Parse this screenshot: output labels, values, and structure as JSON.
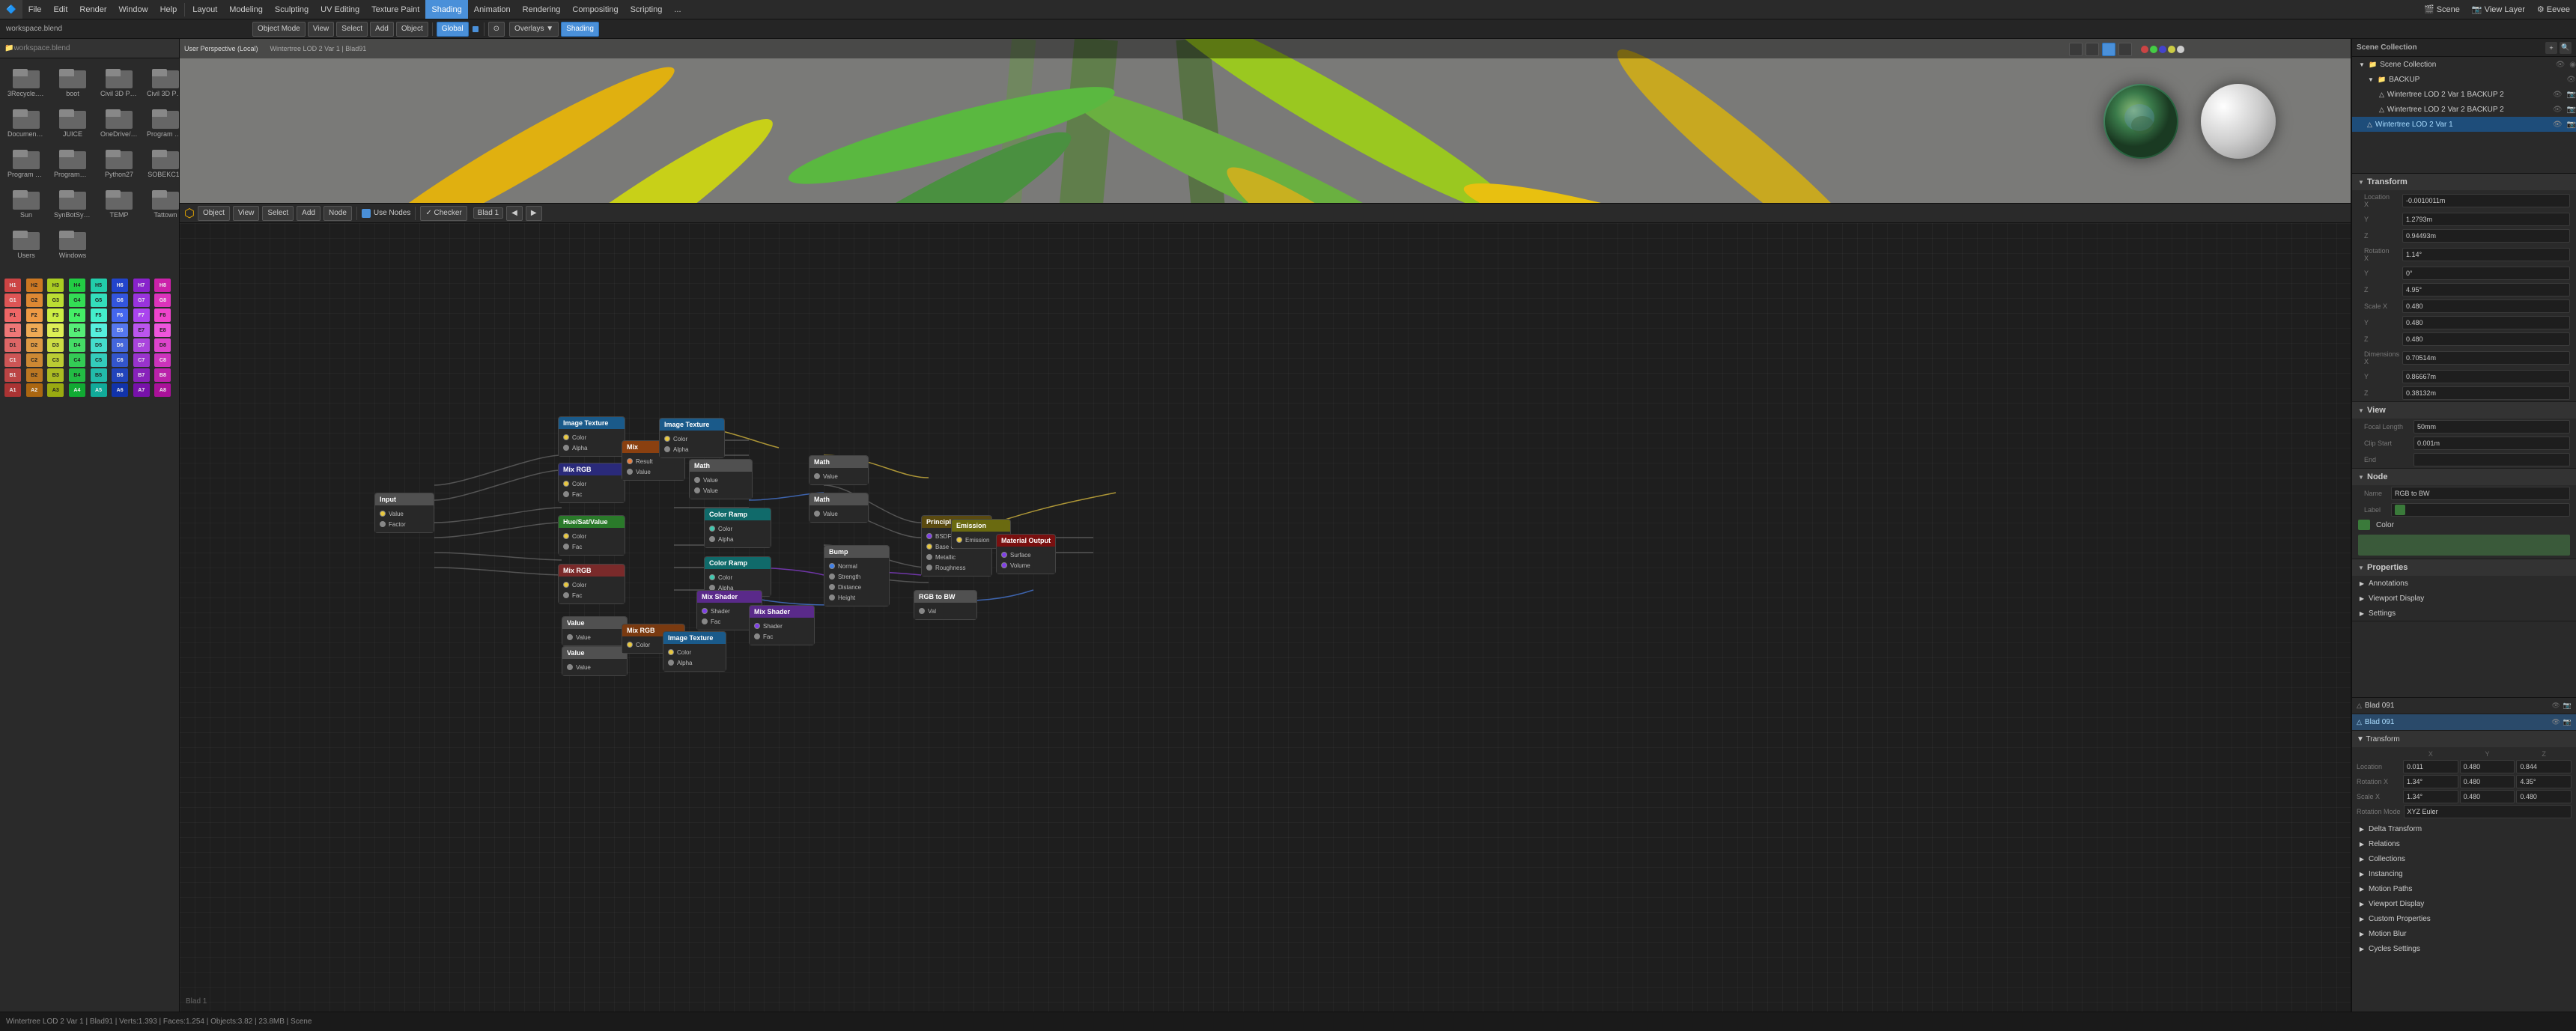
{
  "topMenu": {
    "items": [
      "Blender",
      "File",
      "Edit",
      "Render",
      "Window",
      "Help",
      "Layout",
      "Modeling",
      "Sculpting",
      "UV Editing",
      "Texture Paint",
      "Shading",
      "Animation",
      "Rendering",
      "Compositing",
      "Scripting",
      "..."
    ]
  },
  "workspaceFile": "workspace.blend",
  "viewport": {
    "mode": "Object Mode",
    "view": "View",
    "select": "Select",
    "add": "Add",
    "object": "Object",
    "orientation": "Global",
    "perspective": "User Perspective (Local)",
    "collection": "Wintertree LOD 2 Var 1 | Blad91"
  },
  "nodeEditor": {
    "header": {
      "mode": "Object",
      "view": "View",
      "select": "Select",
      "add": "Add",
      "node": "Node",
      "useNodes": "Use Nodes",
      "label": "Blad 1"
    }
  },
  "rightPanel": {
    "transform": {
      "title": "Transform",
      "location": {
        "label": "Location",
        "x": "-0.0010011m",
        "y": "1.2793m",
        "z": "0.94493m"
      },
      "rotation": {
        "label": "Rotation",
        "x": "1.14°",
        "y": "0°",
        "z": "4.95°",
        "mode": "XYZ Euler"
      },
      "scale": {
        "label": "Scale",
        "x": "0.480",
        "y": "0.480",
        "z": "0.480"
      },
      "dimensions": {
        "label": "Dimensions",
        "x": "0.70514m",
        "y": "0.86667m",
        "z": "0.38132m"
      }
    },
    "view": {
      "title": "View",
      "focalLength": "50mm",
      "clipStart": "0.001m",
      "clipEnd": ""
    },
    "node": {
      "title": "Node",
      "name": "RGB to BW",
      "label": "",
      "color": "Color"
    },
    "properties": {
      "title": "Properties",
      "annotations": "Annotations",
      "viewportDisplay": "Viewport Display",
      "settings": "Settings"
    },
    "sceneCollection": {
      "title": "Scene Collection",
      "items": [
        {
          "name": "Scene Collection",
          "level": 0,
          "expanded": true
        },
        {
          "name": "BACKUP",
          "level": 1,
          "expanded": true
        },
        {
          "name": "Wintertree LOD 2 Var 1 BACKUP 2",
          "level": 2,
          "visible": true
        },
        {
          "name": "Wintertree LOD 2 Var 2 BACKUP 2",
          "level": 2,
          "visible": true
        },
        {
          "name": "Wintertree LOD 2 Var 1",
          "level": 1,
          "selected": true,
          "visible": true
        }
      ]
    }
  },
  "bottomRightPanel": {
    "items": [
      {
        "name": "Blad 091",
        "id": "Blad 091",
        "selected": false
      },
      {
        "name": "Blad 091",
        "id": "Blad 091b",
        "selected": true
      }
    ],
    "transform": {
      "locationX": "0.011",
      "locationY": "0.480",
      "locationZ": "0.844",
      "rotationX": "1.34°",
      "rotationY": "0.480",
      "rotationZ": "4.35°",
      "scaleX": "1.34°",
      "scaleY": "0.480",
      "scaleZ": "0.480",
      "rotationMode": "XYZ Euler"
    },
    "sections": [
      "Delta Transform",
      "Relations",
      "Collections",
      "Instancing",
      "Motion Paths",
      "Viewport Display",
      "Custom Properties",
      "Motion Blur",
      "Cycles Settings"
    ]
  },
  "statusBar": {
    "info": "Wintertree LOD 2 Var 1 | Blad91 | Verts:1.393 | Faces:1.254 | Objects:3.82 | 23.8MB | Scene"
  },
  "fileBrowser": {
    "title": "workspace.blend",
    "folders": [
      "3Recycle.Bin",
      "boot",
      "Civil 3D Props.",
      "Civil 3D Props.",
      "Documents s.",
      "JUICE",
      "OneDrive/Temp",
      "Program Files",
      "Program Files.",
      "ProgramData",
      "Python27",
      "SOBEKC12",
      "Sun",
      "SynBotSyNo.",
      "TEMP",
      "Tattown",
      "Users",
      "Windows"
    ]
  },
  "colorPalette": {
    "rows": [
      [
        "H1",
        "H2",
        "H3",
        "H4",
        "H5",
        "H6",
        "H7",
        "H8"
      ],
      [
        "G1",
        "G2",
        "G3",
        "G4",
        "G5",
        "G6",
        "G7",
        "G8"
      ],
      [
        "P1",
        "F2",
        "F3",
        "F4",
        "F5",
        "F6",
        "F7",
        "F8"
      ],
      [
        "E1",
        "E2",
        "E3",
        "E4",
        "E5",
        "E6",
        "E7",
        "E8"
      ],
      [
        "D1",
        "D2",
        "D3",
        "D4",
        "D5",
        "D6",
        "D7",
        "D8"
      ],
      [
        "C1",
        "C2",
        "C3",
        "C4",
        "C5",
        "C6",
        "C7",
        "C8"
      ],
      [
        "B1",
        "B2",
        "B3",
        "B4",
        "B5",
        "B6",
        "B7",
        "B8"
      ],
      [
        "A1",
        "A2",
        "A3",
        "A4",
        "A5",
        "A6",
        "A7",
        "A8"
      ]
    ],
    "colors": {
      "H1": "#cc4444",
      "H2": "#cc7722",
      "H3": "#aacc22",
      "H4": "#22cc44",
      "H5": "#22ccaa",
      "H6": "#2244cc",
      "H7": "#8822cc",
      "H8": "#cc22aa",
      "G1": "#dd5555",
      "G2": "#dd8833",
      "G3": "#bbdd33",
      "G4": "#33dd55",
      "G5": "#33ddbb",
      "G6": "#3355dd",
      "G7": "#9933dd",
      "G8": "#dd33bb",
      "P1": "#ee6666",
      "F2": "#ee9944",
      "F3": "#ccee44",
      "F4": "#44ee66",
      "F5": "#44eecc",
      "F6": "#4466ee",
      "F7": "#aa44ee",
      "F8": "#ee44cc",
      "E1": "#ee7777",
      "E2": "#eeaa55",
      "E3": "#ddee55",
      "E4": "#55ee77",
      "E5": "#55eedd",
      "E6": "#5577ee",
      "E7": "#bb55ee",
      "E8": "#ee55dd",
      "D1": "#dd6666",
      "D2": "#dd9944",
      "D3": "#ccdd44",
      "D4": "#44dd66",
      "D5": "#44ddcc",
      "D6": "#4466dd",
      "D7": "#aa44dd",
      "D8": "#dd44cc",
      "C1": "#cc5555",
      "C2": "#cc8833",
      "C3": "#bbcc33",
      "C4": "#33cc55",
      "C5": "#33ccbb",
      "C6": "#3355cc",
      "C7": "#9933cc",
      "C8": "#cc33bb",
      "B1": "#bb4444",
      "B2": "#bb7722",
      "B3": "#aabb22",
      "B4": "#22bb44",
      "B5": "#22bbaa",
      "B6": "#2244bb",
      "B7": "#8822bb",
      "B8": "#bb22aa",
      "A1": "#aa3333",
      "A2": "#aa6611",
      "A3": "#99aa11",
      "A4": "#11aa33",
      "A5": "#11aa99",
      "A6": "#1133aa",
      "A7": "#7711aa",
      "A8": "#aa1199"
    }
  }
}
